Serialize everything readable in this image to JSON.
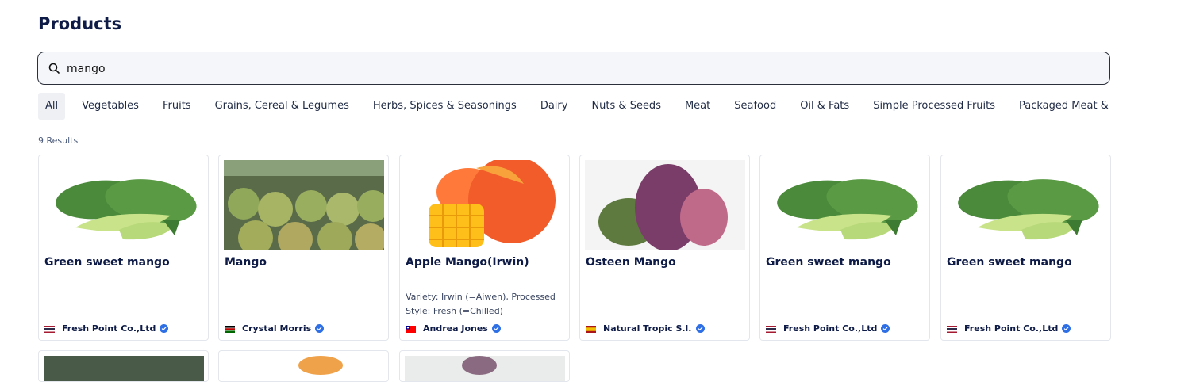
{
  "page": {
    "title": "Products"
  },
  "search": {
    "value": "mango",
    "placeholder": ""
  },
  "categories": [
    "All",
    "Vegetables",
    "Fruits",
    "Grains, Cereal & Legumes",
    "Herbs, Spices & Seasonings",
    "Dairy",
    "Nuts & Seeds",
    "Meat",
    "Seafood",
    "Oil & Fats",
    "Simple Processed Fruits",
    "Packaged Meat & Seafood"
  ],
  "active_category": "All",
  "results": {
    "label": "9 Results"
  },
  "products": [
    {
      "name": "Green sweet mango",
      "description": "",
      "seller": "Fresh Point Co.,Ltd",
      "flag": "thailand-flag-icon",
      "image": "green-mango-image"
    },
    {
      "name": "Mango",
      "description": "",
      "seller": "Crystal Morris",
      "flag": "kenya-flag-icon",
      "image": "crate-mango-image"
    },
    {
      "name": "Apple Mango(Irwin)",
      "description": "Variety: Irwin (=Aiwen), Processed Style: Fresh (=Chilled)",
      "seller": "Andrea Jones",
      "flag": "taiwan-flag-icon",
      "image": "apple-mango-image"
    },
    {
      "name": "Osteen Mango",
      "description": "",
      "seller": "Natural Tropic S.l.",
      "flag": "spain-flag-icon",
      "image": "osteen-mango-image"
    },
    {
      "name": "Green sweet mango",
      "description": "",
      "seller": "Fresh Point Co.,Ltd",
      "flag": "thailand-flag-icon",
      "image": "green-mango-image"
    },
    {
      "name": "Green sweet mango",
      "description": "",
      "seller": "Fresh Point Co.,Ltd",
      "flag": "thailand-flag-icon",
      "image": "green-mango-image"
    }
  ],
  "colors": {
    "accent": "#0e1b46",
    "verified": "#2f6fe6",
    "border": "#e3e6ec"
  }
}
